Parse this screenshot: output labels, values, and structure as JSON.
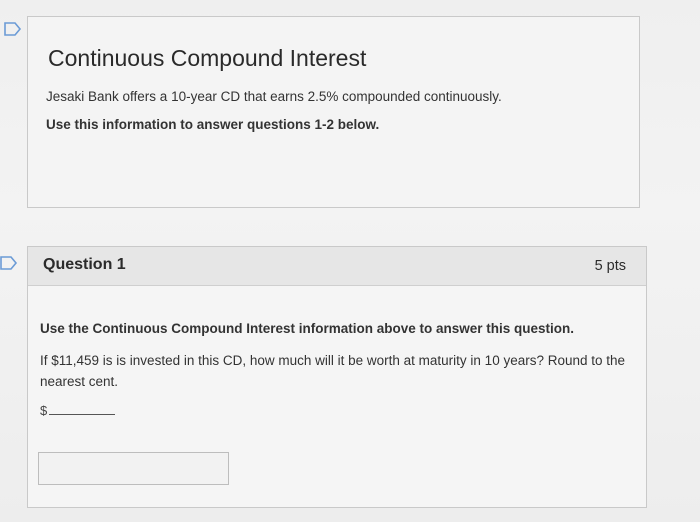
{
  "intro": {
    "title": "Continuous Compound Interest",
    "description": "Jesaki Bank offers a 10-year CD that earns 2.5% compounded continuously.",
    "instruction": "Use this information to answer questions 1-2 below."
  },
  "question": {
    "title": "Question 1",
    "points": "5 pts",
    "line1": "Use the Continuous Compound Interest information above to answer this question.",
    "line2": "If $11,459 is is invested in this CD, how much will it be worth at maturity in 10 years? Round to the nearest cent.",
    "currency": "$",
    "answer_value": ""
  },
  "icons": {
    "intro_flag": "flag-icon",
    "question_flag": "flag-icon"
  },
  "colors": {
    "flag_outline": "#6b9bd6",
    "header_bg": "#e6e6e6",
    "box_border": "#c9c9c9"
  }
}
